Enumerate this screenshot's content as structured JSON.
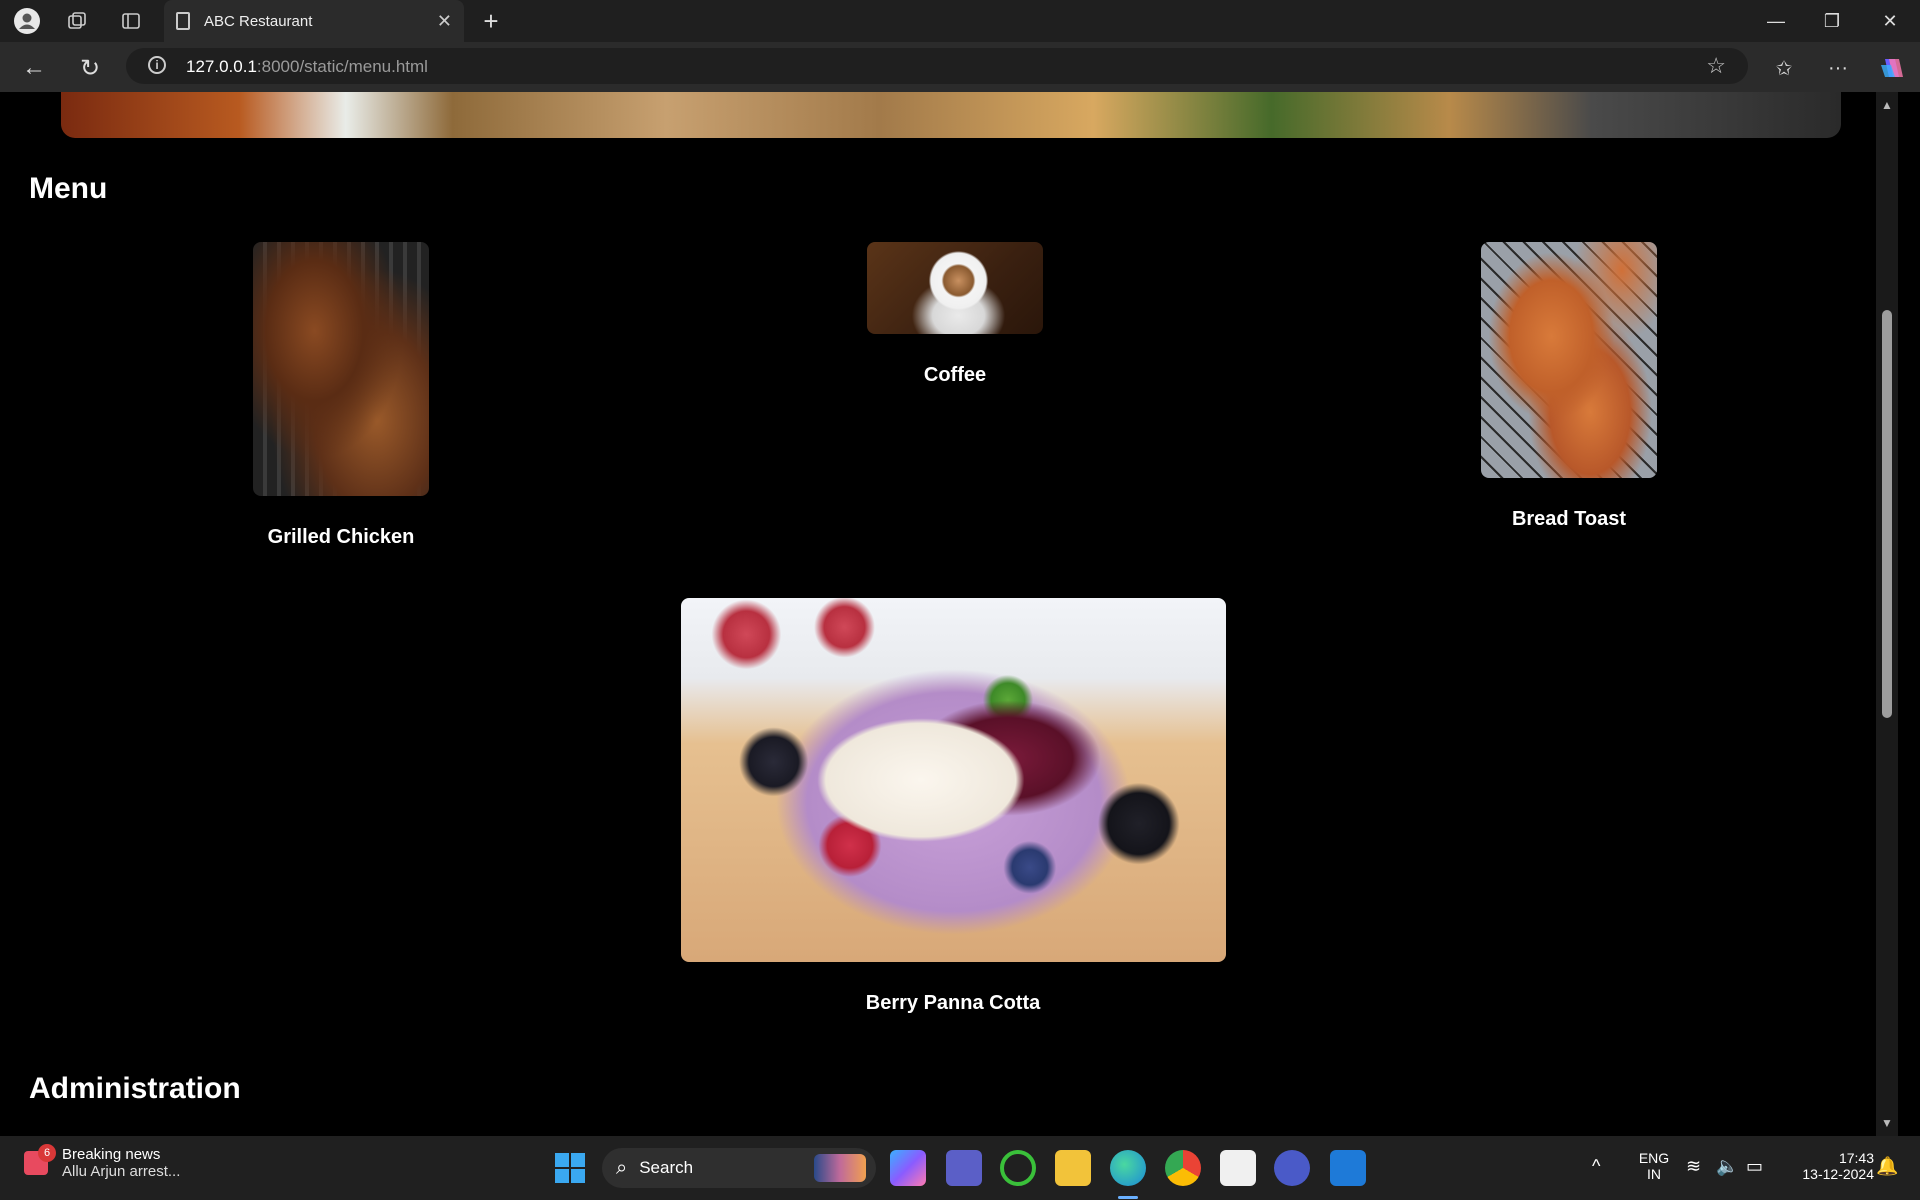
{
  "browser": {
    "tab_title": "ABC Restaurant",
    "new_tab": "+",
    "url_host": "127.0.0.1",
    "url_path": ":8000/static/menu.html"
  },
  "page": {
    "menu_heading": "Menu",
    "items": [
      {
        "label": "Grilled Chicken"
      },
      {
        "label": "Coffee"
      },
      {
        "label": "Bread Toast"
      },
      {
        "label": "Berry Panna Cotta"
      }
    ],
    "admin_heading": "Administration"
  },
  "taskbar": {
    "news_count": "6",
    "news_title": "Breaking news",
    "news_sub": "Allu Arjun arrest...",
    "search_label": "Search",
    "lang_top": "ENG",
    "lang_bottom": "IN",
    "time": "17:43",
    "date": "13-12-2024"
  },
  "colors": {
    "page_bg": "#000000",
    "chrome_bg": "#1f1f1f",
    "taskbar_bg": "#202020"
  }
}
